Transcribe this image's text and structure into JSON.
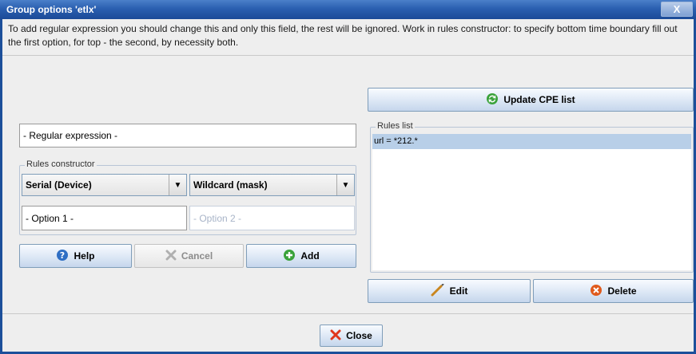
{
  "window": {
    "title": "Group options 'etlx'",
    "close_glyph": "X"
  },
  "description": "To add regular expression you should change this and only this field, the rest will be ignored. Work in rules constructor: to specify bottom time boundary fill out the first option, for top - the second, by necessity both.",
  "update_button": {
    "label": "Update CPE list",
    "icon": "refresh-icon"
  },
  "regex_field": {
    "value": "- Regular expression -"
  },
  "rules_constructor": {
    "legend": "Rules constructor",
    "field_select": "Serial (Device)",
    "match_select": "Wildcard (mask)",
    "option1": "- Option 1 -",
    "option2": "- Option 2 -"
  },
  "buttons": {
    "help": "Help",
    "cancel": "Cancel",
    "add": "Add",
    "edit": "Edit",
    "delete": "Delete",
    "close": "Close"
  },
  "rules_list": {
    "legend": "Rules list",
    "items": [
      "url = *212.*"
    ]
  },
  "colors": {
    "titlebar": "#2a5fb0",
    "selection": "#b8cfe8",
    "delete_icon": "#e05a1c",
    "add_icon": "#3aa23a"
  }
}
